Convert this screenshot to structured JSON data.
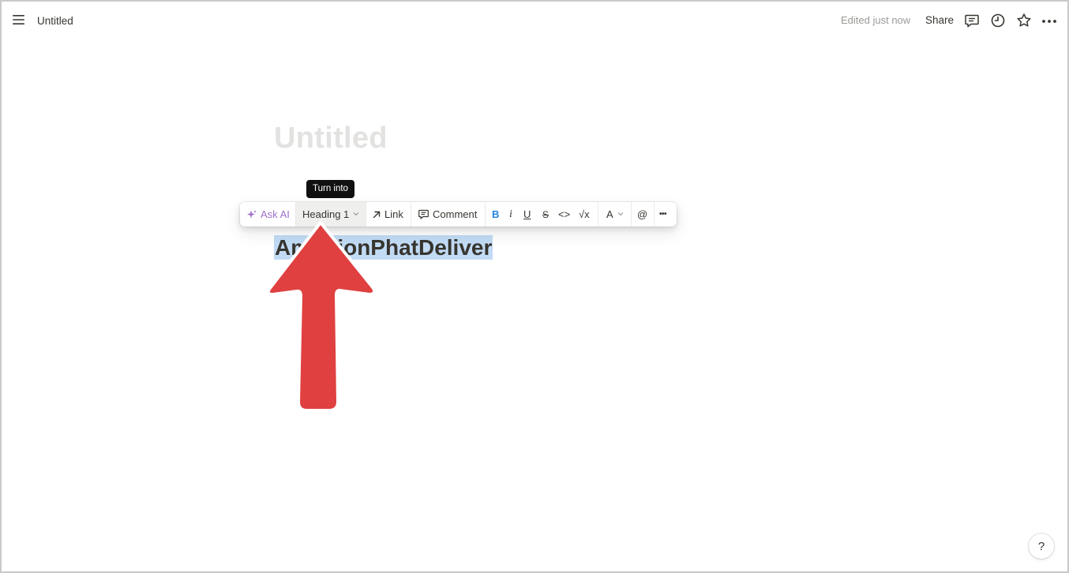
{
  "topbar": {
    "page_title": "Untitled",
    "edited_status": "Edited just now",
    "share_label": "Share"
  },
  "page": {
    "title_placeholder": "Untitled",
    "heading_selected_text": "AmbitionPhatDeliver"
  },
  "tooltip": {
    "text": "Turn into"
  },
  "toolbar": {
    "ask_ai": "Ask AI",
    "block_type": "Heading 1",
    "link": "Link",
    "comment": "Comment",
    "bold": "B",
    "italic": "i",
    "underline": "U",
    "strike": "S",
    "code": "<>",
    "equation": "√x",
    "text_color": "A",
    "mention": "@",
    "more": "•••"
  },
  "help": {
    "label": "?"
  },
  "colors": {
    "accent_ai": "#a06fcc",
    "bold_blue": "#2383e2",
    "selection": "#c2dbf5",
    "arrow_red": "#e04040"
  }
}
